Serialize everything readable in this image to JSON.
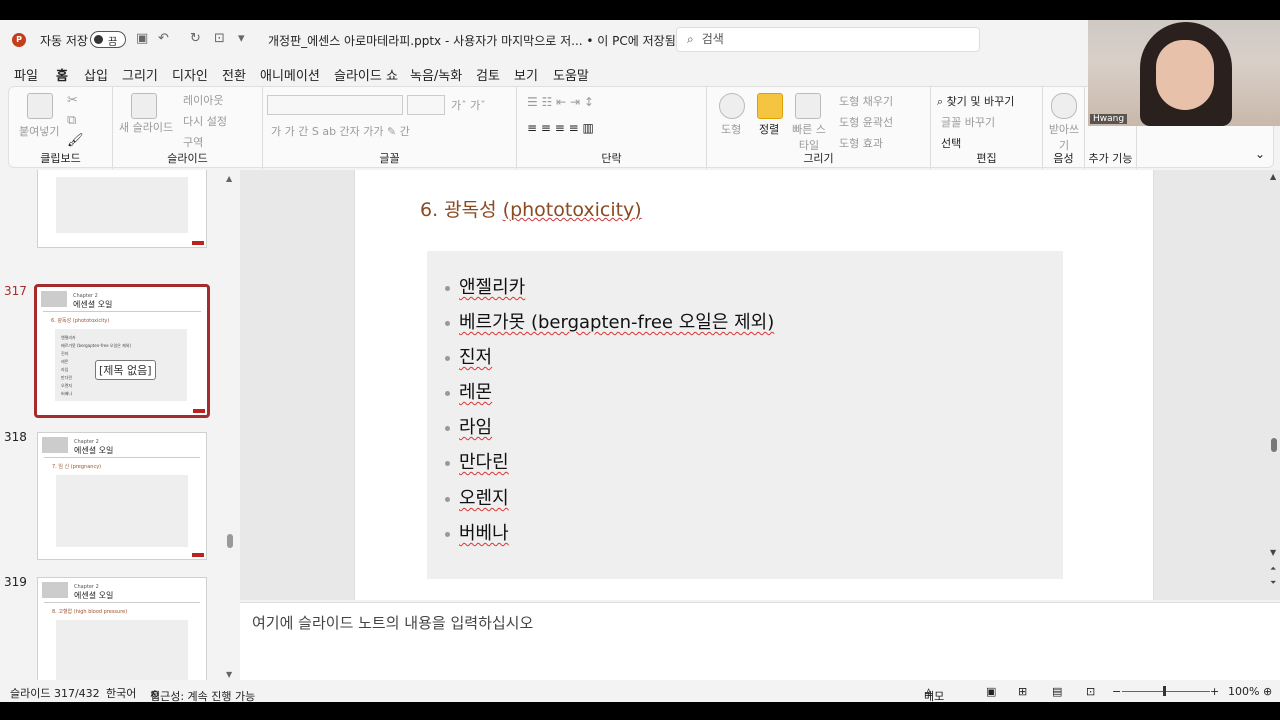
{
  "titlebar": {
    "autosave_label": "자동 저장",
    "toggle_state": "끔",
    "filename": "개정판_에센스 아로마테라피.pptx  -  사용자가 마지막으로 저...  • 이 PC에 저장됨",
    "search_placeholder": "검색"
  },
  "menu": [
    "파일",
    "홈",
    "삽입",
    "그리기",
    "디자인",
    "전환",
    "애니메이션",
    "슬라이드 쇼",
    "녹음/녹화",
    "검토",
    "보기",
    "도움말"
  ],
  "menu_active": "홈",
  "ribbon": {
    "clipboard": {
      "paste": "붙여넣기",
      "label": "클립보드"
    },
    "slides": {
      "new_slide": "새 슬라이드",
      "layout": "레이아웃",
      "reset": "다시 설정",
      "section": "구역",
      "label": "슬라이드"
    },
    "font": {
      "label": "글꼴"
    },
    "paragraph": {
      "label": "단락"
    },
    "drawing": {
      "shape": "도형",
      "arrange": "정렬",
      "quick_style": "빠른 스타일",
      "fill": "도형 채우기",
      "outline": "도형 윤곽선",
      "effect": "도형 효과",
      "label": "그리기"
    },
    "editing": {
      "find_replace": "찾기 및 바꾸기",
      "replace_font": "글꼴 바꾸기",
      "select": "선택",
      "label": "편집"
    },
    "voice": {
      "dictate": "받아쓰기",
      "label": "음성"
    },
    "addins": {
      "label": "추가 기능",
      "item": "추가 기능"
    }
  },
  "thumbnails": [
    {
      "number": "317",
      "chapter": "Chapter 2",
      "title": "에센셜 오일",
      "subtitle": "6. 광독성 (phototoxicity)",
      "selected": true,
      "tooltip": "[제목 없음]",
      "items": [
        "앤젤리카",
        "베르가못 (bergapten-free 오일은 제외)",
        "진저",
        "레몬",
        "라임",
        "만다린",
        "오렌지",
        "버베나"
      ]
    },
    {
      "number": "318",
      "chapter": "Chapter 2",
      "title": "에센셜 오일",
      "subtitle": "7. 임 신 (pregnancy)",
      "selected": false
    },
    {
      "number": "319",
      "chapter": "Chapter 2",
      "title": "에센셜 오일",
      "subtitle": "8. 고혈압 (high blood pressure)",
      "selected": false
    }
  ],
  "slide": {
    "title_prefix": "6. 광독성 ",
    "title_term": "(phototoxicity)",
    "items": [
      "앤젤리카",
      "베르가못 (bergapten-free 오일은 제외)",
      "진저",
      "레몬",
      "라임",
      "만다린",
      "오렌지",
      "버베나"
    ]
  },
  "notes_placeholder": "여기에 슬라이드 노트의 내용을 입력하십시오",
  "status": {
    "slide_count": "슬라이드 317/432",
    "language": "한국어",
    "accessibility": "접근성: 계속 진행 가능",
    "notes": "메모",
    "zoom": "100%"
  },
  "webcam": {
    "name": "Hwang"
  },
  "colors": {
    "accent": "#c43e1c",
    "selected_border": "#a52c2c",
    "title_color": "#8a4a22"
  }
}
